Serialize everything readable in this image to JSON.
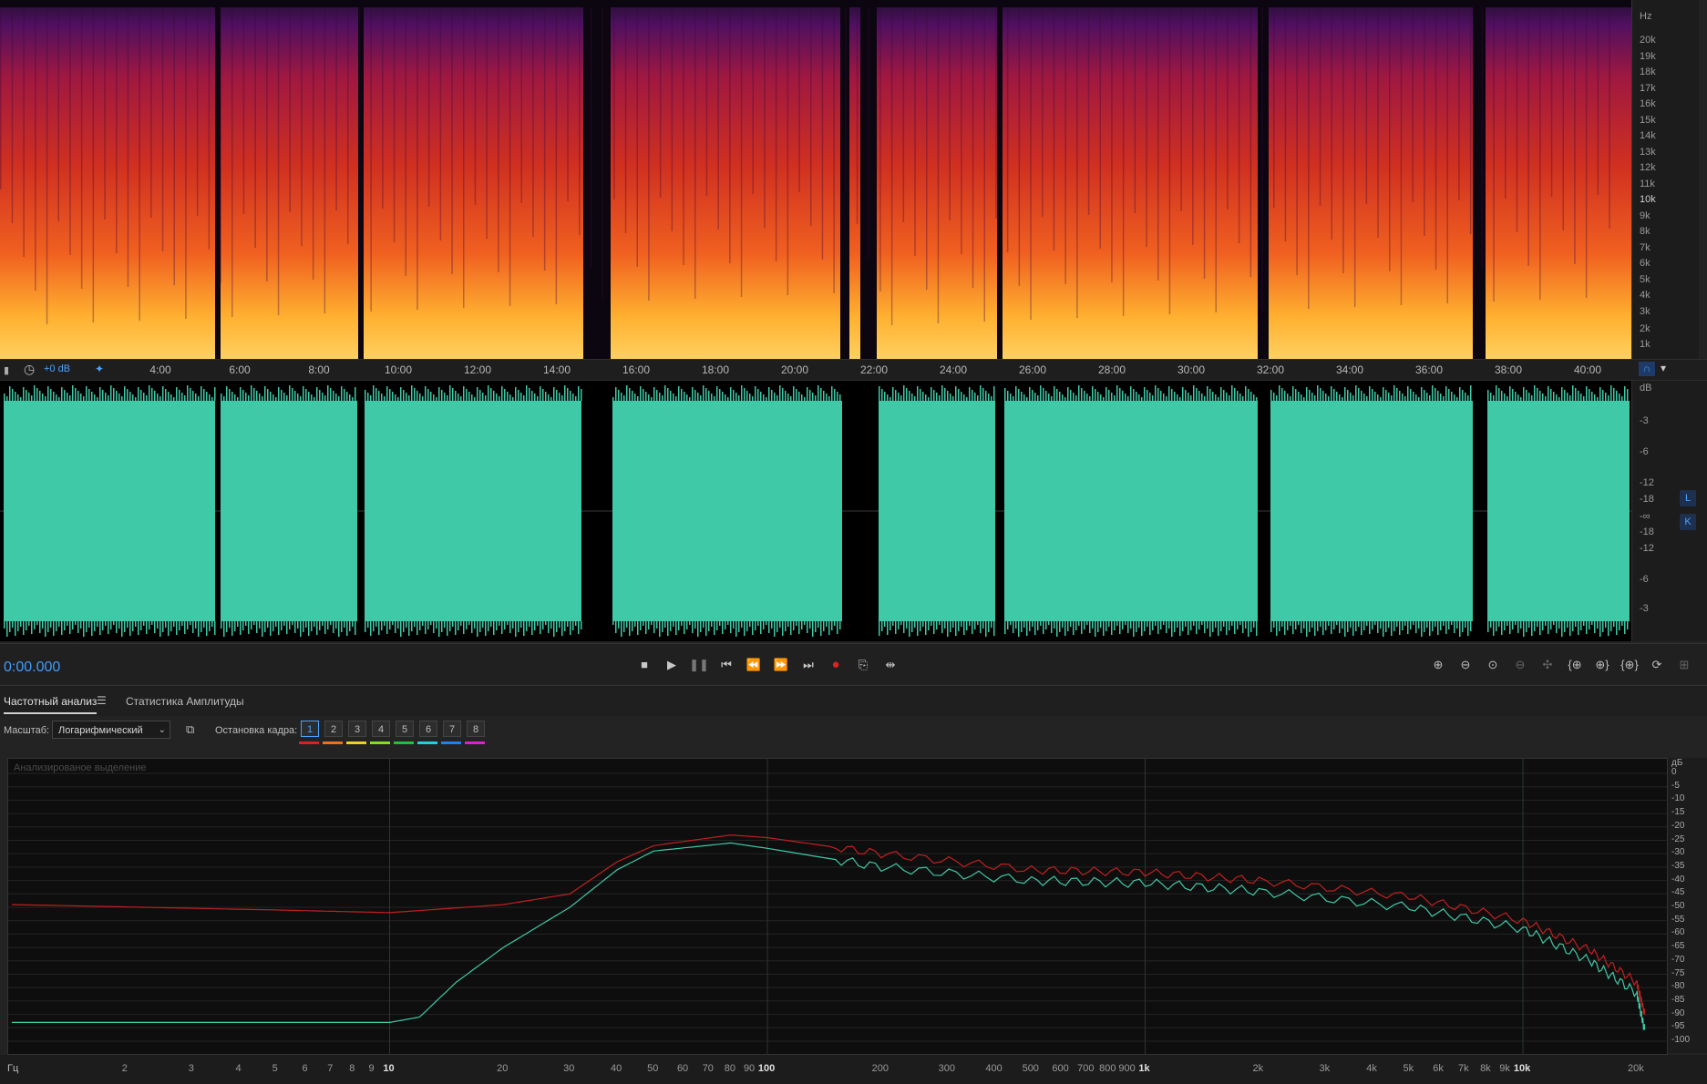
{
  "spectrogram": {
    "hz_unit": "Hz",
    "hz_labels": [
      "20k",
      "19k",
      "18k",
      "17k",
      "16k",
      "15k",
      "14k",
      "13k",
      "12k",
      "11k",
      "10k",
      "9k",
      "8k",
      "7k",
      "6k",
      "5k",
      "4k",
      "3k",
      "2k",
      "1k"
    ]
  },
  "timeline": {
    "gain_label": "+0 dB",
    "labels": [
      "4:00",
      "6:00",
      "8:00",
      "10:00",
      "12:00",
      "14:00",
      "16:00",
      "18:00",
      "20:00",
      "22:00",
      "24:00",
      "26:00",
      "28:00",
      "30:00",
      "32:00",
      "34:00",
      "36:00",
      "38:00",
      "40:00"
    ]
  },
  "waveform": {
    "db_unit": "dB",
    "db_labels": [
      "-3",
      "-6",
      "-12",
      "-18",
      "-∞",
      "-18",
      "-12",
      "-6",
      "-3"
    ],
    "channel_left": "L",
    "channel_right": "K",
    "color": "#3fc9a6"
  },
  "transport": {
    "timecode": "0:00.000"
  },
  "panel": {
    "tab_frequency": "Частотный анализ",
    "tab_amplitude": "Статистика Амплитуды",
    "scale_label": "Масштаб:",
    "scale_value": "Логарифмический",
    "freeze_label": "Остановка кадра:",
    "frames": [
      "1",
      "2",
      "3",
      "4",
      "5",
      "6",
      "7",
      "8"
    ],
    "frame_colors": [
      "#e02020",
      "#f07020",
      "#f0d020",
      "#80e020",
      "#20c040",
      "#20d0e0",
      "#2080f0",
      "#e020d0"
    ]
  },
  "frequency_plot": {
    "overlay_label": "Анализированое выделение",
    "db_unit": "дБ",
    "db_labels": [
      "0",
      "-5",
      "-10",
      "-15",
      "-20",
      "-25",
      "-30",
      "-35",
      "-40",
      "-45",
      "-50",
      "-55",
      "-60",
      "-65",
      "-70",
      "-75",
      "-80",
      "-85",
      "-90",
      "-95",
      "-100"
    ],
    "hz_unit": "Гц",
    "hz_labels": [
      "2",
      "3",
      "4",
      "5",
      "6",
      "7",
      "8",
      "9",
      "10",
      "20",
      "30",
      "40",
      "50",
      "60",
      "70",
      "80",
      "90",
      "100",
      "200",
      "300",
      "400",
      "500",
      "600",
      "700",
      "800",
      "900",
      "1k",
      "2k",
      "3k",
      "4k",
      "5k",
      "6k",
      "7k",
      "8k",
      "9k",
      "10k",
      "20k"
    ],
    "series_colors": [
      "#c02020",
      "#3fc9a6"
    ]
  }
}
